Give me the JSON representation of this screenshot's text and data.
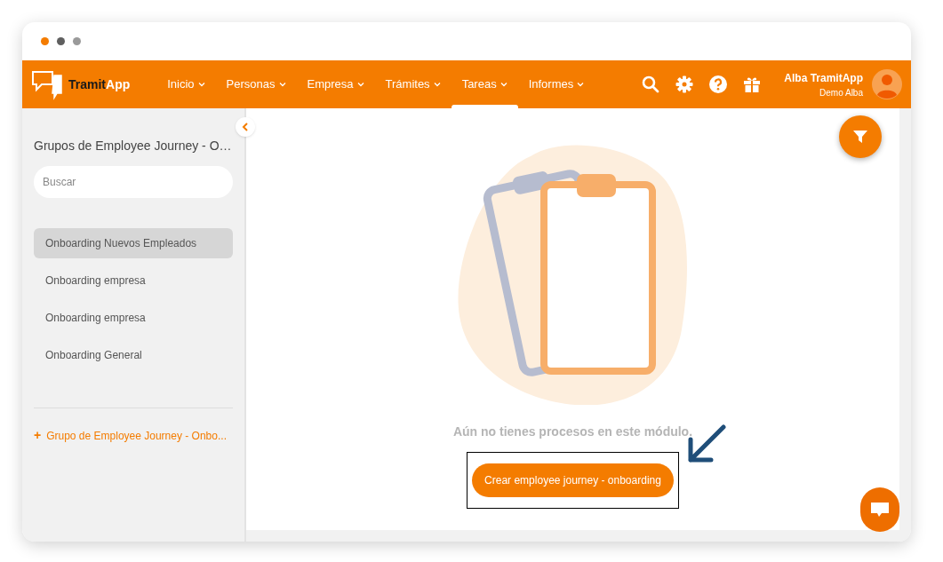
{
  "window_dots": [
    {
      "color": "#f47c00"
    },
    {
      "color": "#5f5f5f"
    },
    {
      "color": "#9a9a9a"
    }
  ],
  "logo": {
    "part1": "Tramit",
    "part2": "App"
  },
  "nav": [
    {
      "label": "Inicio",
      "selected": false
    },
    {
      "label": "Personas",
      "selected": false
    },
    {
      "label": "Empresa",
      "selected": false
    },
    {
      "label": "Trámites",
      "selected": false
    },
    {
      "label": "Tareas",
      "selected": true
    },
    {
      "label": "Informes",
      "selected": false
    }
  ],
  "user": {
    "name": "Alba TramitApp",
    "company": "Demo Alba"
  },
  "sidebar": {
    "title": "Grupos de Employee Journey - O…",
    "search": {
      "placeholder": "Buscar"
    },
    "items": [
      {
        "label": "Onboarding Nuevos Empleados",
        "selected": true
      },
      {
        "label": "Onboarding empresa",
        "selected": false
      },
      {
        "label": "Onboarding empresa",
        "selected": false
      },
      {
        "label": "Onboarding General",
        "selected": false
      }
    ],
    "add_link": {
      "icon": "+",
      "label": "Grupo de Employee Journey - Onbo..."
    }
  },
  "empty_state": {
    "message": "Aún no tienes procesos en este módulo.",
    "button": "Crear employee journey - onboarding"
  }
}
